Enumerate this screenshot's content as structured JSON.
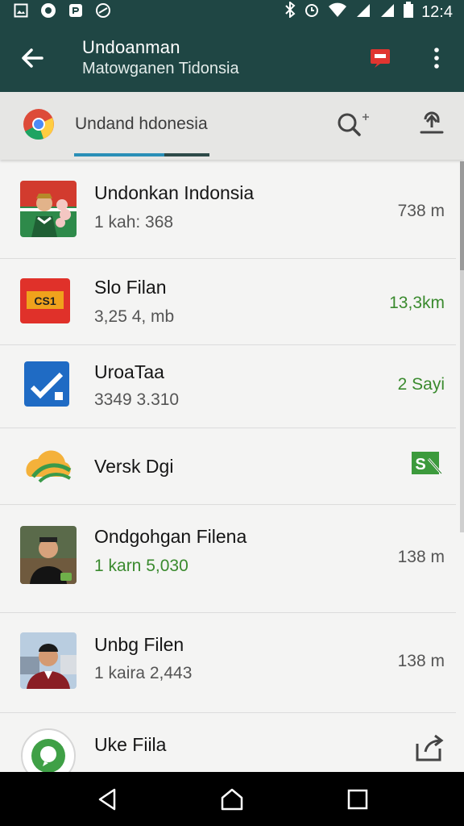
{
  "status_bar": {
    "time": "12:4"
  },
  "app_bar": {
    "title": "Undoanman",
    "subtitle": "Matowganen Tidonsia"
  },
  "search": {
    "text": "Undand hdonesia"
  },
  "items": [
    {
      "name": "Undonkan Indonsia",
      "sub": "1 kah: 368",
      "meta": "738 m"
    },
    {
      "name": "Slo Filan",
      "sub": "3,25 4, mb",
      "meta": "13,3km"
    },
    {
      "name": "UroaTaa",
      "sub": "3349 3.310",
      "meta": "2 Sayi"
    },
    {
      "name": "Versk Dgi",
      "sub": "",
      "meta": ""
    },
    {
      "name": "Ondgohgan Filena",
      "sub": "1 karn 5,030",
      "meta": "138 m"
    },
    {
      "name": "Unbg Filen",
      "sub": "1 kaira 2,443",
      "meta": "138 m"
    },
    {
      "name": "Uke Fiila",
      "sub": "",
      "meta": ""
    }
  ],
  "colors": {
    "appbar": "#1f4644",
    "accent": "#2a8fb7",
    "green": "#3a8a2e"
  }
}
